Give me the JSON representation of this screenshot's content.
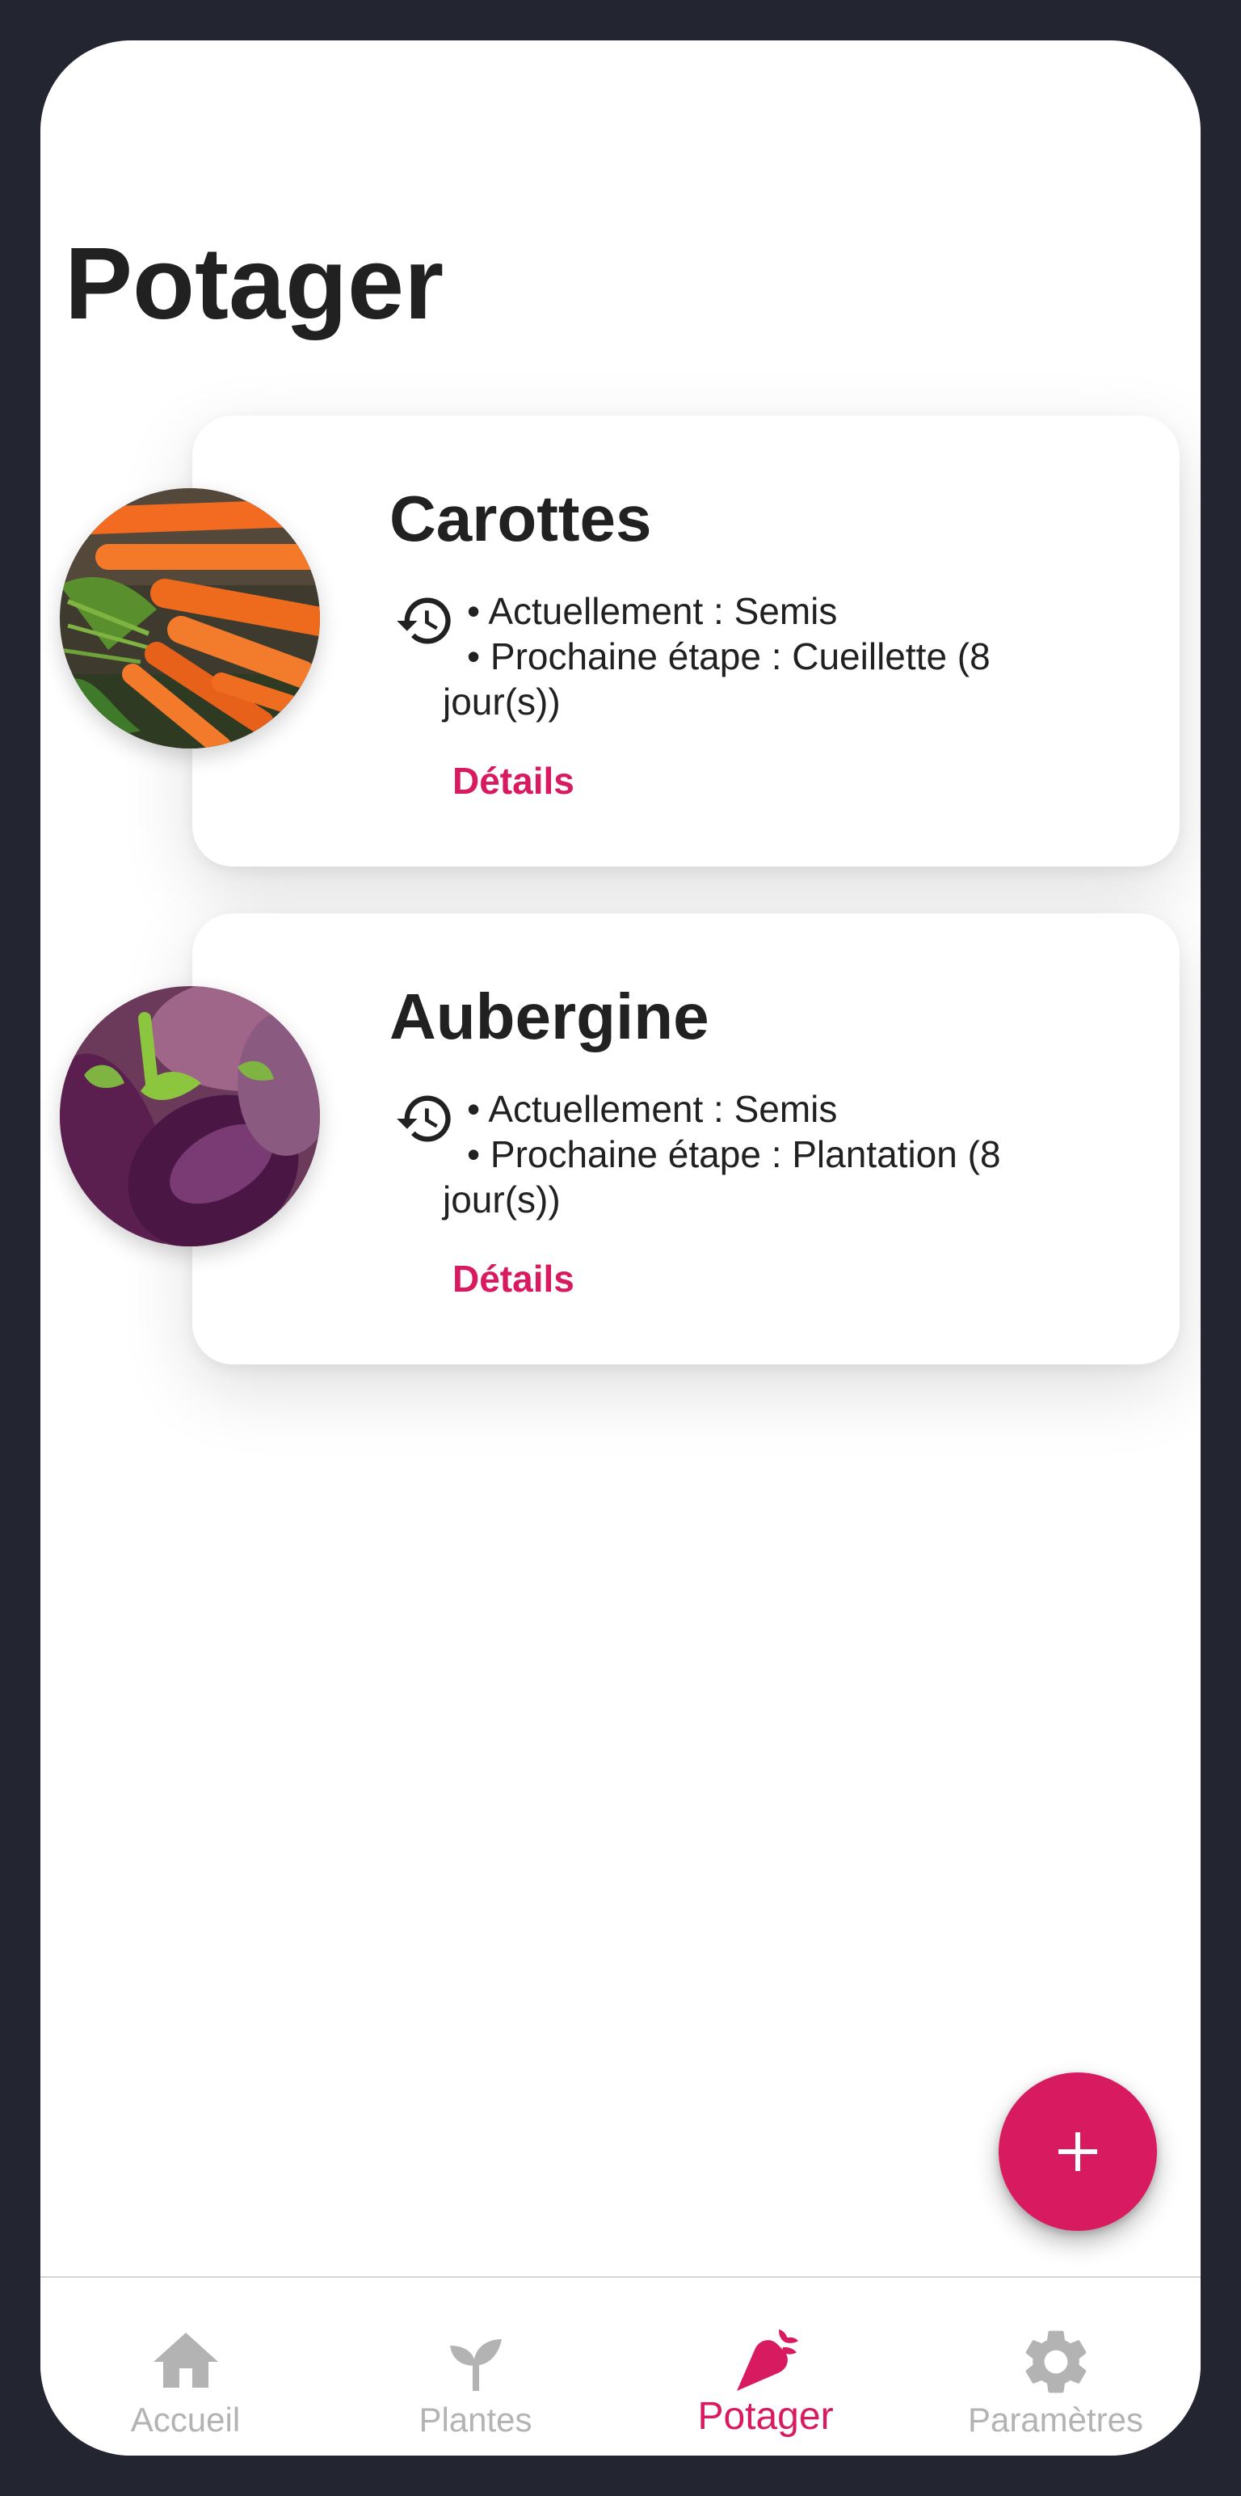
{
  "page": {
    "title": "Potager"
  },
  "colors": {
    "accent": "#d81b60",
    "inactive": "#b3b3b3",
    "frame": "#232631",
    "text": "#212121"
  },
  "plants": [
    {
      "name": "Carottes",
      "image_icon": "carrots-photo",
      "status_icon": "history-icon",
      "current_stage": "• Actuellement : Semis",
      "next_stage_first": "• Prochaine étape : Cueillette (8",
      "next_stage_rest": "jour(s))",
      "details_label": "Détails"
    },
    {
      "name": "Aubergine",
      "image_icon": "eggplant-photo",
      "status_icon": "history-icon",
      "current_stage": "• Actuellement : Semis",
      "next_stage_first": "• Prochaine étape : Plantation (8",
      "next_stage_rest": "jour(s))",
      "details_label": "Détails"
    }
  ],
  "fab": {
    "icon": "plus-icon"
  },
  "bottom_nav": {
    "items": [
      {
        "label": "Accueil",
        "icon": "home-icon",
        "active": false
      },
      {
        "label": "Plantes",
        "icon": "sprout-icon",
        "active": false
      },
      {
        "label": "Potager",
        "icon": "carrot-icon",
        "active": true
      },
      {
        "label": "Paramètres",
        "icon": "gear-icon",
        "active": false
      }
    ]
  }
}
